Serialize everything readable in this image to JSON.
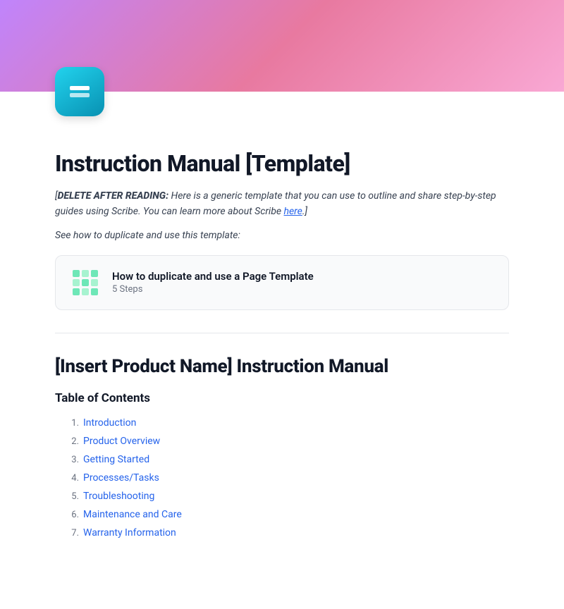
{
  "hero": {
    "gradient_start": "#c084fc",
    "gradient_end": "#f9a8d4"
  },
  "app_icon": {
    "alt": "Instruction Manual App Icon"
  },
  "page": {
    "main_title": "Instruction Manual [Template]",
    "delete_notice_label": "DELETE AFTER READING:",
    "delete_notice_text": " Here is a generic template that you can use to outline and share step-by-step guides using Scribe. You can learn more about Scribe ",
    "delete_notice_link": "here",
    "delete_notice_end": ".]",
    "see_how_text": "See how to duplicate and use this template:",
    "template_card": {
      "title": "How to duplicate and use a Page Template",
      "steps": "5 Steps"
    }
  },
  "manual": {
    "section_title": "[Insert Product Name] Instruction Manual",
    "toc_heading": "Table of Contents",
    "toc_items": [
      {
        "num": "1.",
        "label": "Introduction"
      },
      {
        "num": "2.",
        "label": "Product Overview"
      },
      {
        "num": "3.",
        "label": "Getting Started"
      },
      {
        "num": "4.",
        "label": "Processes/Tasks"
      },
      {
        "num": "5.",
        "label": "Troubleshooting"
      },
      {
        "num": "6.",
        "label": "Maintenance and Care"
      },
      {
        "num": "7.",
        "label": "Warranty Information"
      }
    ]
  }
}
